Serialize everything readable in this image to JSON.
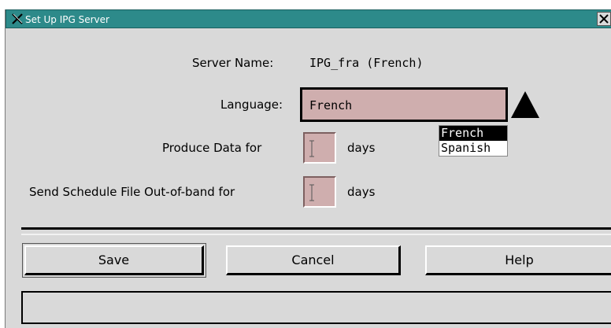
{
  "window": {
    "title": "Set Up IPG Server"
  },
  "form": {
    "server_name_label": "Server Name:",
    "server_name_value": "IPG_fra (French)",
    "language_label": "Language:",
    "language_value": "French",
    "language_options": [
      {
        "label": "French",
        "selected": true
      },
      {
        "label": "Spanish",
        "selected": false
      }
    ],
    "produce_label": "Produce Data for",
    "produce_value": "",
    "produce_unit": "days",
    "send_label": "Send Schedule File Out-of-band for",
    "send_value": "",
    "send_unit": "days"
  },
  "buttons": {
    "save": "Save",
    "cancel": "Cancel",
    "help": "Help"
  },
  "status": {
    "text": ""
  },
  "colors": {
    "titlebar": "#2d8a8a",
    "panel": "#d9d9d9",
    "field_fill": "#cfaeae"
  },
  "icons": {
    "app": "x-window-icon",
    "close": "close-icon",
    "dropdown": "triangle-up-icon"
  }
}
